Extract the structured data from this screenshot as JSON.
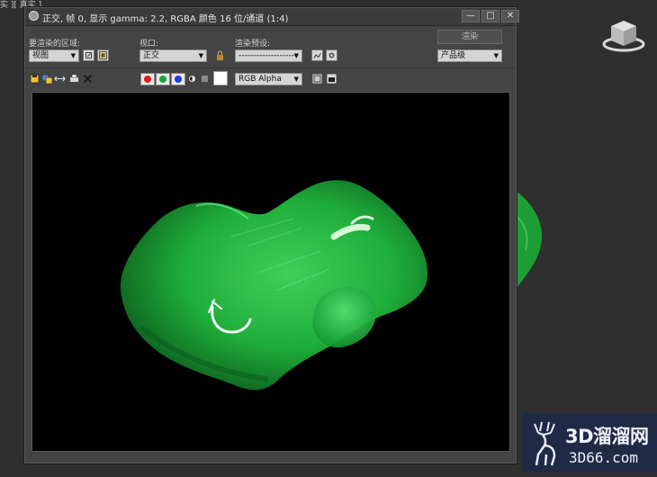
{
  "viewport": {
    "label": "实 ][ 真实 ]"
  },
  "window": {
    "title": "正交, 帧 0, 显示 gamma: 2.2, RGBA 颜色 16 位/通道 (1:4)",
    "controls": {
      "minimize": "—",
      "maximize": "□",
      "close": "✕"
    }
  },
  "toolbar": {
    "area_label": "要渲染的区域:",
    "area_value": "视图",
    "viewport_label": "视口:",
    "viewport_value": "正交",
    "preset_label": "渲染预设:",
    "preset_value": "--------------------",
    "render_button": "渲染",
    "quality_value": "产品级",
    "channel_value": "RGB Alpha"
  },
  "colors": {
    "channel_red": "#e01b1b",
    "channel_green": "#17a53a",
    "channel_blue": "#1b3fe0",
    "render_background": "#000000",
    "jade": "#1fae3a"
  },
  "icons": [
    "save-image-icon",
    "copy-image-icon",
    "clone-window-icon",
    "print-icon",
    "clear-icon",
    "lock-icon",
    "environment-icon",
    "teapot-render-icon",
    "display-alpha-icon",
    "mono-icon",
    "viewcube-icon"
  ],
  "watermark": {
    "cn": "3D溜溜网",
    "en": "3D66.com"
  }
}
